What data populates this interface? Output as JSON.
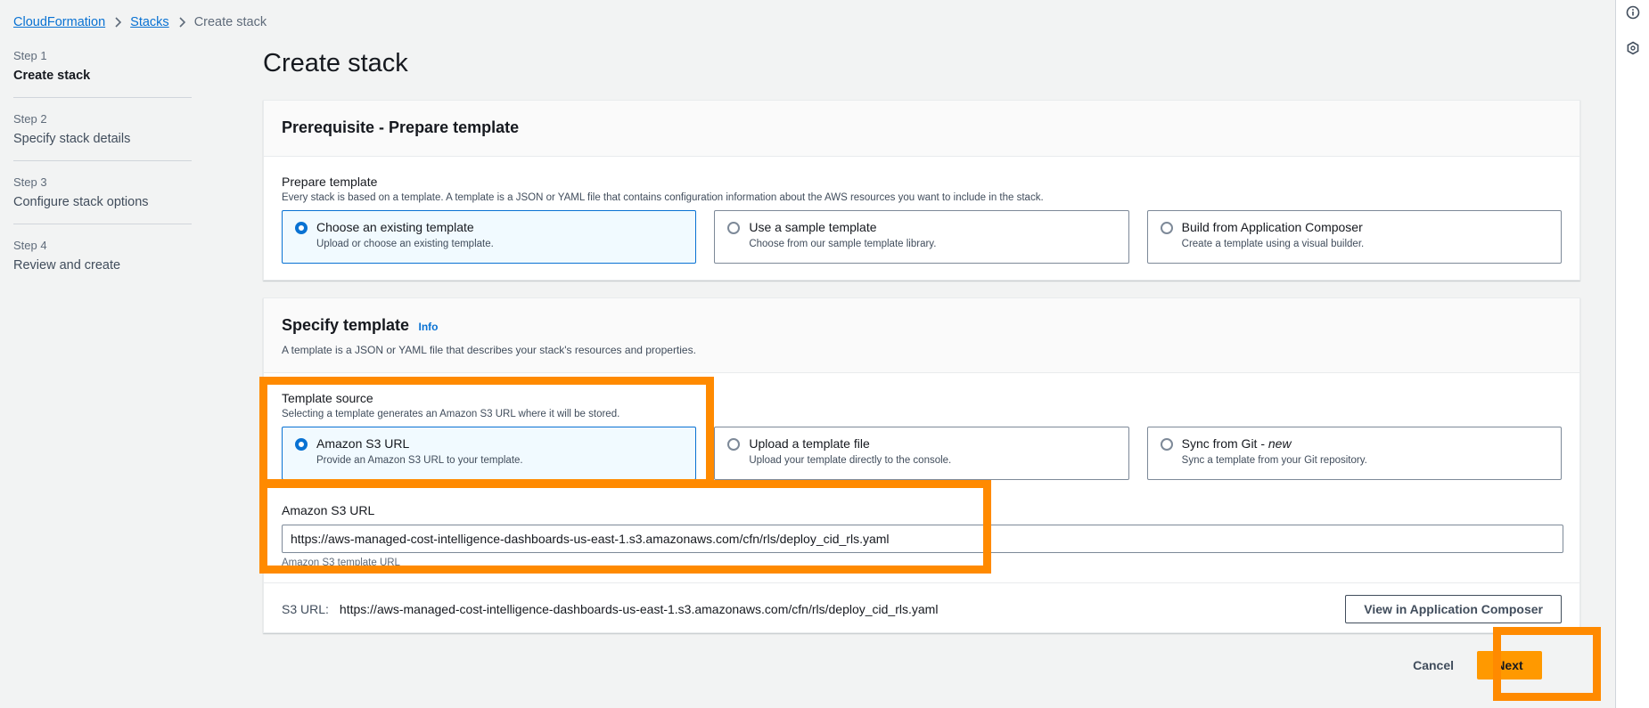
{
  "breadcrumb": {
    "items": [
      "CloudFormation",
      "Stacks"
    ],
    "current": "Create stack"
  },
  "steps": [
    {
      "num": "Step 1",
      "name": "Create stack"
    },
    {
      "num": "Step 2",
      "name": "Specify stack details"
    },
    {
      "num": "Step 3",
      "name": "Configure stack options"
    },
    {
      "num": "Step 4",
      "name": "Review and create"
    }
  ],
  "page_title": "Create stack",
  "prereq": {
    "header": "Prerequisite - Prepare template",
    "label": "Prepare template",
    "description": "Every stack is based on a template. A template is a JSON or YAML file that contains configuration information about the AWS resources you want to include in the stack.",
    "options": [
      {
        "title": "Choose an existing template",
        "desc": "Upload or choose an existing template."
      },
      {
        "title": "Use a sample template",
        "desc": "Choose from our sample template library."
      },
      {
        "title": "Build from Application Composer",
        "desc": "Create a template using a visual builder."
      }
    ]
  },
  "specify": {
    "header": "Specify template",
    "info": "Info",
    "description": "A template is a JSON or YAML file that describes your stack's resources and properties.",
    "source_label": "Template source",
    "source_desc": "Selecting a template generates an Amazon S3 URL where it will be stored.",
    "options": [
      {
        "title": "Amazon S3 URL",
        "desc": "Provide an Amazon S3 URL to your template."
      },
      {
        "title": "Upload a template file",
        "desc": "Upload your template directly to the console."
      },
      {
        "title_main": "Sync from Git - ",
        "title_em": "new",
        "desc": "Sync a template from your Git repository."
      }
    ],
    "url_label": "Amazon S3 URL",
    "url_value": "https://aws-managed-cost-intelligence-dashboards-us-east-1.s3.amazonaws.com/cfn/rls/deploy_cid_rls.yaml",
    "url_constraint": "Amazon S3 template URL",
    "s3_label": "S3 URL:",
    "s3_value": "https://aws-managed-cost-intelligence-dashboards-us-east-1.s3.amazonaws.com/cfn/rls/deploy_cid_rls.yaml",
    "view_button": "View in Application Composer"
  },
  "actions": {
    "cancel": "Cancel",
    "next": "Next"
  },
  "colors": {
    "highlight": "#ff8a00",
    "primary": "#ff9900",
    "link": "#0972d3"
  },
  "icons": [
    "info-icon",
    "feedback-icon",
    "chevron-right-icon"
  ]
}
